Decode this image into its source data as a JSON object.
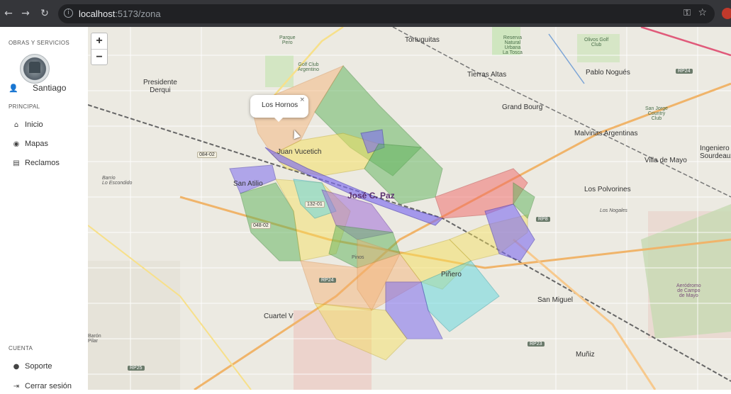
{
  "browser": {
    "url_host": "localhost",
    "url_path": ":5173/zona",
    "back_icon": "arrow-left-icon",
    "forward_icon": "arrow-right-icon",
    "reload_icon": "reload-icon",
    "key_icon": "key-icon",
    "star_icon": "star-icon"
  },
  "sidebar": {
    "header": "OBRAS Y SERVICIOS",
    "user_name": "Santiago",
    "section_principal": "PRINCIPAL",
    "items": [
      {
        "label": "Inicio",
        "icon": "home-icon"
      },
      {
        "label": "Mapas",
        "icon": "compass-icon"
      },
      {
        "label": "Reclamos",
        "icon": "clipboard-icon"
      }
    ],
    "section_cuenta": "CUENTA",
    "account_items": [
      {
        "label": "Soporte",
        "icon": "help-icon"
      },
      {
        "label": "Cerrar sesión",
        "icon": "logout-icon"
      }
    ]
  },
  "map": {
    "zoom_in": "+",
    "zoom_out": "−",
    "popup_text": "Los Hornos",
    "popup_close": "×",
    "labels": {
      "tortuguitas": "Tortuguitas",
      "tierras_altas": "Tierras Altas",
      "pablo_nogues": "Pablo Nogués",
      "presidente_derqui": "Presidente\nDerqui",
      "grand_bourg": "Grand Bourg",
      "malvinas": "Malvinas Argentinas",
      "ingeniero": "Ingeniero\nSourdeaux",
      "villa_de_mayo": "Villa de Mayo",
      "los_polvorines": "Los Polvorines",
      "jose_c_paz": "José C. Paz",
      "san_atilio": "San Atilio",
      "juan_vucetich": "Juan Vucetich",
      "pinero": "Piñero",
      "san_miguel": "San Miguel",
      "cuartel_v": "Cuartel V",
      "muniz": "Muñiz",
      "reserva": "Reserva\nNatural\nUrbana\nLa Tosca",
      "olivos_golf": "Olivos Golf\nClub",
      "parque_pero": "Parque\nPero",
      "golf_club_argentino": "Golf Club\nArgentino",
      "san_jorge": "San Jorge\nCountry\nClub",
      "aerodromo": "Aeródromo\nde Campo\nde Mayo",
      "barrio_escondido": "Barrio\nLo Escondido",
      "los_nogales": "Los Nogales",
      "pinos": "Pinos",
      "baron": "Barón\nPilar"
    },
    "roads": {
      "r084": "084-02",
      "r048": "048-02",
      "r132": "132-01",
      "rp24a": "RP24",
      "rp24b": "RP24",
      "rp8": "RP8",
      "rp23": "RP23",
      "rp25": "RP25"
    }
  },
  "colors": {
    "chrome_bg": "#35363a",
    "zone_purple": "#7f6df0",
    "zone_green": "#5fb35a",
    "zone_red": "#f06666",
    "zone_cyan": "#6ad8e0",
    "zone_yellow": "#f5e05a",
    "zone_orange": "#f5b070"
  }
}
